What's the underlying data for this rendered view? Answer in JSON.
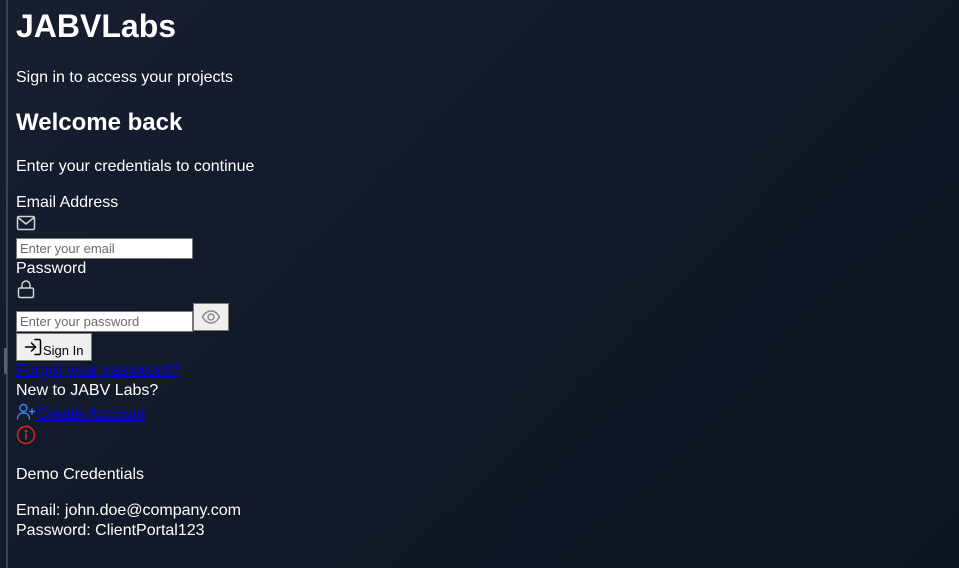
{
  "brand": {
    "title": "JABVLabs",
    "tagline": "Sign in to access your projects"
  },
  "form": {
    "heading": "Welcome back",
    "subtitle": "Enter your credentials to continue",
    "email": {
      "label": "Email Address",
      "placeholder": "Enter your email",
      "icon": "mail-icon"
    },
    "password": {
      "label": "Password",
      "placeholder": "Enter your password",
      "icon": "lock-icon",
      "toggle_icon": "eye-icon"
    },
    "submit_label": "Sign In",
    "submit_icon": "login-icon",
    "forgot_link": "Forgot your password?"
  },
  "signup": {
    "prompt": "New to JABV Labs?",
    "link": "Create Account",
    "icon": "user-plus-icon"
  },
  "demo": {
    "icon": "info-icon",
    "title": "Demo Credentials",
    "email_line": "Email: john.doe@company.com",
    "password_line": "Password: ClientPortal123"
  },
  "colors": {
    "background": "#111827",
    "text": "#ffffff",
    "link": "#0000ee",
    "info_icon": "#dc2626",
    "icon_stroke": "#d1d5db"
  }
}
